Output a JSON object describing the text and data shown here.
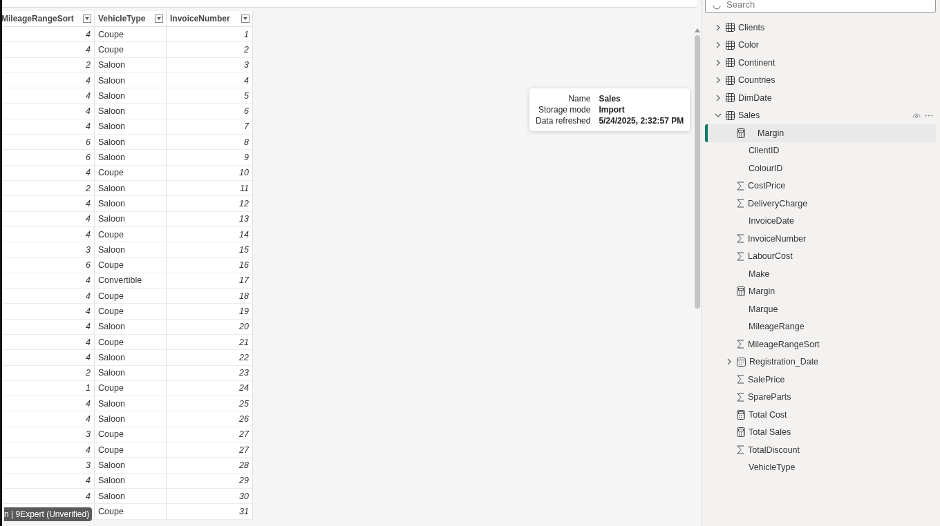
{
  "table": {
    "columns": [
      {
        "label": "MileageRangeSort",
        "kind": "number"
      },
      {
        "label": "VehicleType",
        "kind": "text"
      },
      {
        "label": "InvoiceNumber",
        "kind": "number"
      }
    ],
    "rows": [
      [
        "4",
        "Coupe",
        "1"
      ],
      [
        "4",
        "Coupe",
        "2"
      ],
      [
        "2",
        "Saloon",
        "3"
      ],
      [
        "4",
        "Saloon",
        "4"
      ],
      [
        "4",
        "Saloon",
        "5"
      ],
      [
        "4",
        "Saloon",
        "6"
      ],
      [
        "4",
        "Saloon",
        "7"
      ],
      [
        "6",
        "Saloon",
        "8"
      ],
      [
        "6",
        "Saloon",
        "9"
      ],
      [
        "4",
        "Coupe",
        "10"
      ],
      [
        "2",
        "Saloon",
        "11"
      ],
      [
        "4",
        "Saloon",
        "12"
      ],
      [
        "4",
        "Saloon",
        "13"
      ],
      [
        "4",
        "Coupe",
        "14"
      ],
      [
        "3",
        "Saloon",
        "15"
      ],
      [
        "6",
        "Coupe",
        "16"
      ],
      [
        "4",
        "Convertible",
        "17"
      ],
      [
        "4",
        "Coupe",
        "18"
      ],
      [
        "4",
        "Coupe",
        "19"
      ],
      [
        "4",
        "Saloon",
        "20"
      ],
      [
        "4",
        "Coupe",
        "21"
      ],
      [
        "4",
        "Saloon",
        "22"
      ],
      [
        "2",
        "Saloon",
        "23"
      ],
      [
        "1",
        "Coupe",
        "24"
      ],
      [
        "4",
        "Saloon",
        "25"
      ],
      [
        "4",
        "Saloon",
        "26"
      ],
      [
        "3",
        "Coupe",
        "27"
      ],
      [
        "4",
        "Coupe",
        "27"
      ],
      [
        "3",
        "Saloon",
        "28"
      ],
      [
        "4",
        "Saloon",
        "29"
      ],
      [
        "4",
        "Saloon",
        "30"
      ],
      [
        null,
        "Coupe",
        "31"
      ]
    ]
  },
  "tooltip": {
    "rows": [
      {
        "label": "Name",
        "value": "Sales"
      },
      {
        "label": "Storage mode",
        "value": "Import"
      },
      {
        "label": "Data refreshed",
        "value": "5/24/2025, 2:32:57 PM"
      }
    ]
  },
  "data_pane": {
    "search": {
      "placeholder": "Search"
    },
    "tables": [
      {
        "name": "Clients",
        "expanded": false
      },
      {
        "name": "Color",
        "expanded": false
      },
      {
        "name": "Continent",
        "expanded": false
      },
      {
        "name": "Countries",
        "expanded": false
      },
      {
        "name": "DimDate",
        "expanded": false
      },
      {
        "name": "Sales",
        "expanded": true,
        "children": [
          {
            "name": "Margin",
            "kind": "measure",
            "selected": true
          },
          {
            "name": "ClientID",
            "kind": "plain",
            "selected": false
          },
          {
            "name": "ColourID",
            "kind": "plain",
            "selected": false
          },
          {
            "name": "CostPrice",
            "kind": "sum",
            "selected": false
          },
          {
            "name": "DeliveryCharge",
            "kind": "sum",
            "selected": false
          },
          {
            "name": "InvoiceDate",
            "kind": "plain",
            "selected": false
          },
          {
            "name": "InvoiceNumber",
            "kind": "sum",
            "selected": false
          },
          {
            "name": "LabourCost",
            "kind": "sum",
            "selected": false
          },
          {
            "name": "Make",
            "kind": "plain",
            "selected": false
          },
          {
            "name": "Margin",
            "kind": "measure",
            "selected": false
          },
          {
            "name": "Marque",
            "kind": "plain",
            "selected": false
          },
          {
            "name": "MileageRange",
            "kind": "plain",
            "selected": false
          },
          {
            "name": "MileageRangeSort",
            "kind": "sum",
            "selected": false
          },
          {
            "name": "Registration_Date",
            "kind": "date",
            "selected": false,
            "expanded": false
          },
          {
            "name": "SalePrice",
            "kind": "sum",
            "selected": false
          },
          {
            "name": "SpareParts",
            "kind": "sum",
            "selected": false
          },
          {
            "name": "Total Cost",
            "kind": "measure",
            "selected": false
          },
          {
            "name": "Total Sales",
            "kind": "measure",
            "selected": false
          },
          {
            "name": "TotalDiscount",
            "kind": "sum",
            "selected": false
          },
          {
            "name": "VehicleType",
            "kind": "plain",
            "selected": false
          }
        ]
      }
    ]
  },
  "overlay_label": "n | 9Expert (Unverified)"
}
